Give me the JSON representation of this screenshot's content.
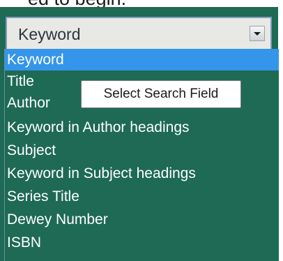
{
  "top_text": "ed to begin.",
  "select": {
    "value": "Keyword",
    "arrow_icon": "chevron-down-icon"
  },
  "dropdown": {
    "selected_index": 0,
    "options": [
      "Keyword",
      "Title",
      "Author",
      "Keyword in Author headings",
      "Subject",
      "Keyword in Subject headings",
      "Series Title",
      "Dewey Number",
      "ISBN"
    ]
  },
  "tooltip": "Select Search Field",
  "colors": {
    "panel": "#1e6a54",
    "selected_option": "#3495ea",
    "select_background": "#e8e8e4"
  }
}
